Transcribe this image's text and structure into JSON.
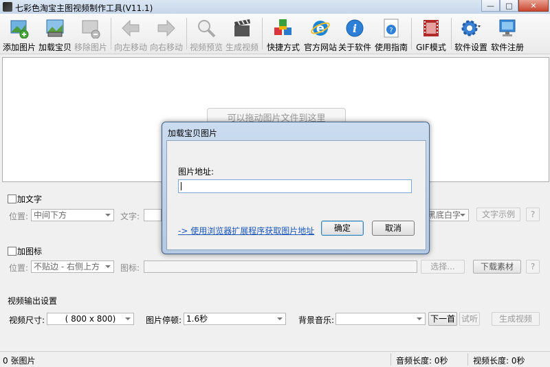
{
  "window": {
    "title": "七彩色淘宝主图视频制作工具(V11.1)"
  },
  "toolbar": {
    "items": [
      {
        "label": "添加图片",
        "icon": "add-image-icon",
        "enabled": true
      },
      {
        "label": "加载宝贝",
        "icon": "load-item-icon",
        "enabled": true
      },
      {
        "label": "移除图片",
        "icon": "remove-image-icon",
        "enabled": false
      },
      {
        "label": "向左移动",
        "icon": "arrow-left-icon",
        "enabled": false
      },
      {
        "label": "向右移动",
        "icon": "arrow-right-icon",
        "enabled": false
      },
      {
        "label": "视频预览",
        "icon": "magnifier-icon",
        "enabled": false
      },
      {
        "label": "生成视频",
        "icon": "clapper-icon",
        "enabled": false
      },
      {
        "label": "快捷方式",
        "icon": "cubes-icon",
        "enabled": true
      },
      {
        "label": "官方网站",
        "icon": "ie-icon",
        "enabled": true
      },
      {
        "label": "关于软件",
        "icon": "info-icon",
        "enabled": true
      },
      {
        "label": "使用指南",
        "icon": "guide-icon",
        "enabled": true
      },
      {
        "label": "GIF模式",
        "icon": "film-icon",
        "enabled": true
      },
      {
        "label": "软件设置",
        "icon": "gear-icon",
        "enabled": true
      },
      {
        "label": "软件注册",
        "icon": "monitor-icon",
        "enabled": true
      }
    ]
  },
  "canvas": {
    "hint": "可以拖动图片文件到这里"
  },
  "text_panel": {
    "checkbox_label": "加文字",
    "position_label": "位置:",
    "position_value": "中间下方",
    "text_label": "文字:",
    "style_value": "黑底白字",
    "sample_button": "文字示例",
    "help_button": "?"
  },
  "logo_panel": {
    "checkbox_label": "加图标",
    "position_label": "位置:",
    "position_value": "不贴边 - 右侧上方",
    "icon_label": "图标:",
    "browse_button": "选择...",
    "download_button": "下载素材",
    "help_button": "?"
  },
  "output_panel": {
    "title": "视频输出设置",
    "size_label": "视频尺寸:",
    "size_value": "( 800 x  800)",
    "pause_label": "图片停顿:",
    "pause_value": "1.6秒",
    "music_label": "背景音乐:",
    "music_value": "",
    "next_button": "下一首",
    "listen_button": "试听",
    "generate_button": "生成视频"
  },
  "status": {
    "images": "0 张图片",
    "audio_length": "音频长度: 0秒",
    "video_length": "视频长度: 0秒"
  },
  "dialog": {
    "title": "加载宝贝图片",
    "url_label": "图片地址:",
    "url_value": "",
    "extension_link": "-> 使用浏览器扩展程序获取图片地址",
    "ok_button": "确定",
    "cancel_button": "取消"
  }
}
